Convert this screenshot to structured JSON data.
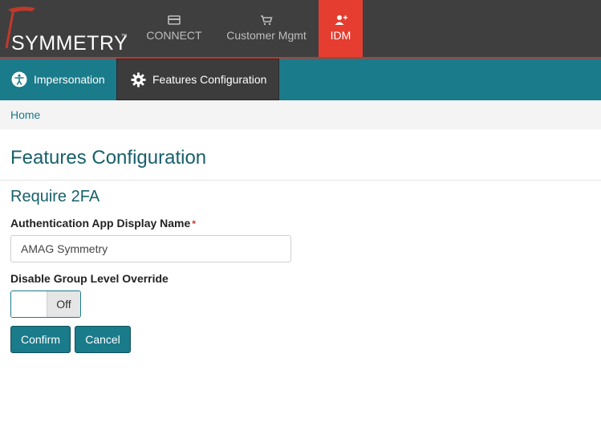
{
  "brand": {
    "name": "SYMMETRY",
    "trademark": "™",
    "accent": "#e53d2f",
    "primary": "#1a7b8a"
  },
  "top_nav": {
    "items": [
      {
        "label": "CONNECT",
        "icon": "card-icon"
      },
      {
        "label": "Customer Mgmt",
        "icon": "cart-icon"
      },
      {
        "label": "IDM",
        "icon": "user-plus-icon",
        "active": true
      }
    ]
  },
  "sub_nav": {
    "tabs": [
      {
        "label": "Impersonation",
        "icon": "accessibility-icon"
      },
      {
        "label": "Features Configuration",
        "icon": "gear-icon",
        "active": true
      }
    ]
  },
  "breadcrumb": {
    "home": "Home"
  },
  "page": {
    "title": "Features Configuration",
    "section_title": "Require 2FA",
    "auth_app_label": "Authentication App Display Name",
    "required_marker": "*",
    "auth_app_value": "AMAG Symmetry",
    "override_label": "Disable Group Level Override",
    "toggle_state": "Off",
    "confirm_label": "Confirm",
    "cancel_label": "Cancel"
  }
}
